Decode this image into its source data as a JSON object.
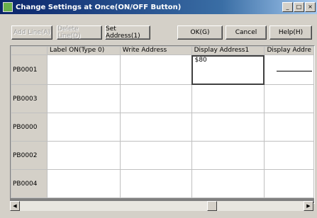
{
  "window": {
    "title": "Change Settings at Once(ON/OFF Button)",
    "min_label": "_",
    "max_label": "□",
    "close_label": "×"
  },
  "toolbar": {
    "add_line": "Add Line(A)",
    "delete_line": "Delete Line(D)",
    "set_address": "Set Address(1)",
    "ok": "OK(G)",
    "cancel": "Cancel",
    "help": "Help(H)"
  },
  "grid": {
    "columns": [
      "Label ON(Type 0)",
      "Write Address",
      "Display Address1",
      "Display Addre"
    ],
    "rows": [
      {
        "label": "PB0001",
        "cells": [
          "",
          "",
          "$80",
          ""
        ]
      },
      {
        "label": "PB0003",
        "cells": [
          "",
          "",
          "",
          ""
        ]
      },
      {
        "label": "PB0000",
        "cells": [
          "",
          "",
          "",
          ""
        ]
      },
      {
        "label": "PB0002",
        "cells": [
          "",
          "",
          "",
          ""
        ]
      },
      {
        "label": "PB0004",
        "cells": [
          "",
          "",
          "",
          ""
        ]
      }
    ]
  },
  "scrollbar": {
    "left_arrow": "◀",
    "right_arrow": "▶"
  }
}
